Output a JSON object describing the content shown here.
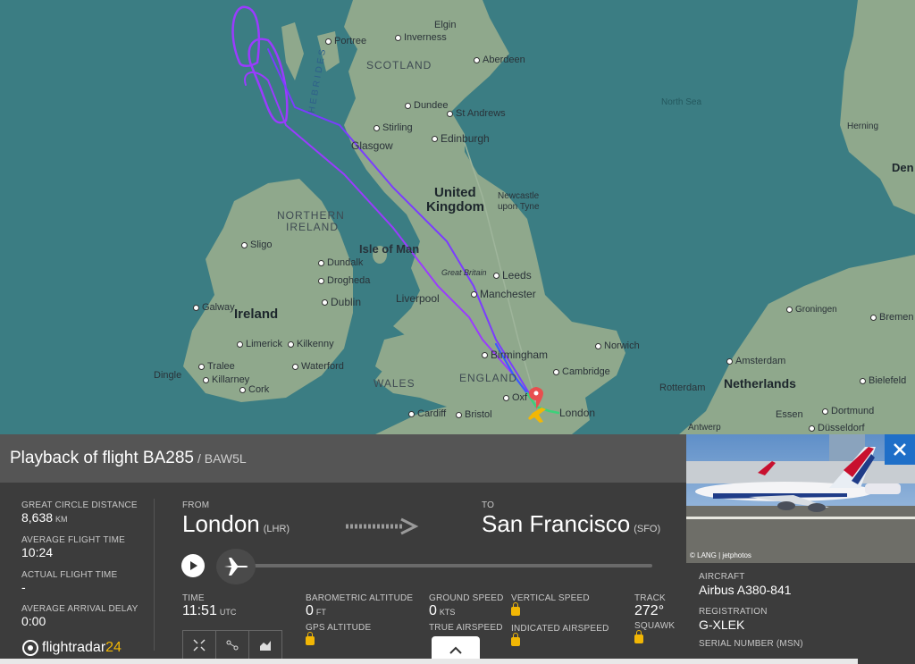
{
  "map": {
    "labels": {
      "portree": "Portree",
      "inverness": "Inverness",
      "elgin": "Elgin",
      "scotland": "SCOTLAND",
      "aberdeen": "Aberdeen",
      "hebrides": "HEBRIDES",
      "dundee": "Dundee",
      "st_andrews": "St Andrews",
      "stirling": "Stirling",
      "glasgow": "Glasgow",
      "edinburgh": "Edinburgh",
      "north_sea": "North Sea",
      "united_kingdom_1": "United",
      "united_kingdom_2": "Kingdom",
      "newcastle_1": "Newcastle",
      "newcastle_2": "upon Tyne",
      "northern_ireland_1": "NORTHERN",
      "northern_ireland_2": "IRELAND",
      "sligo": "Sligo",
      "isle_of_man": "Isle of Man",
      "dundalk": "Dundalk",
      "great_britain": "Great Britain",
      "leeds": "Leeds",
      "drogheda": "Drogheda",
      "manchester": "Manchester",
      "galway": "Galway",
      "dublin": "Dublin",
      "liverpool": "Liverpool",
      "ireland": "Ireland",
      "norwich": "Norwich",
      "limerick": "Limerick",
      "kilkenny": "Kilkenny",
      "birmingham": "Birmingham",
      "tralee": "Tralee",
      "waterford": "Waterford",
      "cambridge": "Cambridge",
      "dingle": "Dingle",
      "killarney": "Killarney",
      "england": "ENGLAND",
      "cork": "Cork",
      "wales": "WALES",
      "oxford": "Oxf",
      "cardiff": "Cardiff",
      "bristol": "Bristol",
      "london": "London",
      "herning": "Herning",
      "den": "Den",
      "groningen": "Groningen",
      "bremen": "Bremen",
      "amsterdam": "Amsterdam",
      "rotterdam": "Rotterdam",
      "netherlands": "Netherlands",
      "bielefeld": "Bielefeld",
      "essen": "Essen",
      "dortmund": "Dortmund",
      "antwerp": "Antwerp",
      "dusseldorf": "Düsseldorf"
    }
  },
  "panel": {
    "title": "Playback of flight BA285",
    "callsign": "/ BAW5L",
    "great_circle_label": "GREAT CIRCLE DISTANCE",
    "great_circle_value": "8,638",
    "great_circle_unit": "KM",
    "avg_flight_time_label": "AVERAGE FLIGHT TIME",
    "avg_flight_time_value": "10:24",
    "actual_flight_time_label": "ACTUAL FLIGHT TIME",
    "actual_flight_time_value": "-",
    "avg_arrival_delay_label": "AVERAGE ARRIVAL DELAY",
    "avg_arrival_delay_value": "0:00",
    "from_label": "FROM",
    "from_city": "London",
    "from_code": "(LHR)",
    "to_label": "TO",
    "to_city": "San Francisco",
    "to_code": "(SFO)",
    "time_label": "TIME",
    "time_value": "11:51",
    "time_unit": "UTC",
    "baro_alt_label": "BAROMETRIC ALTITUDE",
    "baro_alt_value": "0",
    "baro_alt_unit": "FT",
    "gps_alt_label": "GPS ALTITUDE",
    "ground_speed_label": "GROUND SPEED",
    "ground_speed_value": "0",
    "ground_speed_unit": "KTS",
    "true_airspeed_label": "TRUE AIRSPEED",
    "vertical_speed_label": "VERTICAL SPEED",
    "indicated_airspeed_label": "INDICATED AIRSPEED",
    "track_label": "TRACK",
    "track_value": "272°",
    "squawk_label": "SQUAWK",
    "logo_text": "flightradar",
    "logo_num": "24"
  },
  "side": {
    "photo_credit": "© LANG | jetphotos",
    "aircraft_label": "AIRCRAFT",
    "aircraft_value": "Airbus A380-841",
    "registration_label": "REGISTRATION",
    "registration_value": "G-XLEK",
    "serial_label": "SERIAL NUMBER (MSN)"
  },
  "colors": {
    "sea": "#3b7d83",
    "land": "#8fa88c",
    "panel": "#3c3c3c",
    "panel_head": "#555555",
    "accent_blue": "#1f6fc8",
    "lock_yellow": "#f2b705",
    "track_purple": "#9b3bff",
    "track_blue": "#3a5cff",
    "track_green": "#3dd17a"
  }
}
